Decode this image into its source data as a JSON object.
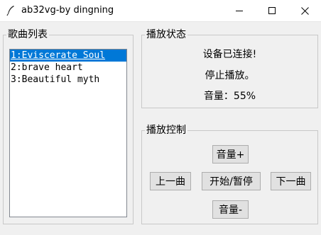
{
  "window": {
    "title": "ab32vg-by dingning"
  },
  "playlist": {
    "label": "歌曲列表",
    "items": [
      "1:Eviscerate Soul",
      "2:brave heart",
      "3:Beautiful myth"
    ],
    "selected_index": 0
  },
  "status": {
    "label": "播放状态",
    "connection": "设备已连接!",
    "playback": "停止播放。",
    "volume": "音量：55%"
  },
  "control": {
    "label": "播放控制",
    "vol_up": "音量+",
    "prev": "上一曲",
    "play_pause": "开始/暂停",
    "next": "下一曲",
    "vol_down": "音量-"
  },
  "colors": {
    "selection": "#0078d7",
    "background": "#f0f0f0"
  },
  "icons": {
    "app": "feather-icon",
    "minimize": "minimize-icon",
    "maximize": "maximize-icon",
    "close": "close-icon"
  }
}
